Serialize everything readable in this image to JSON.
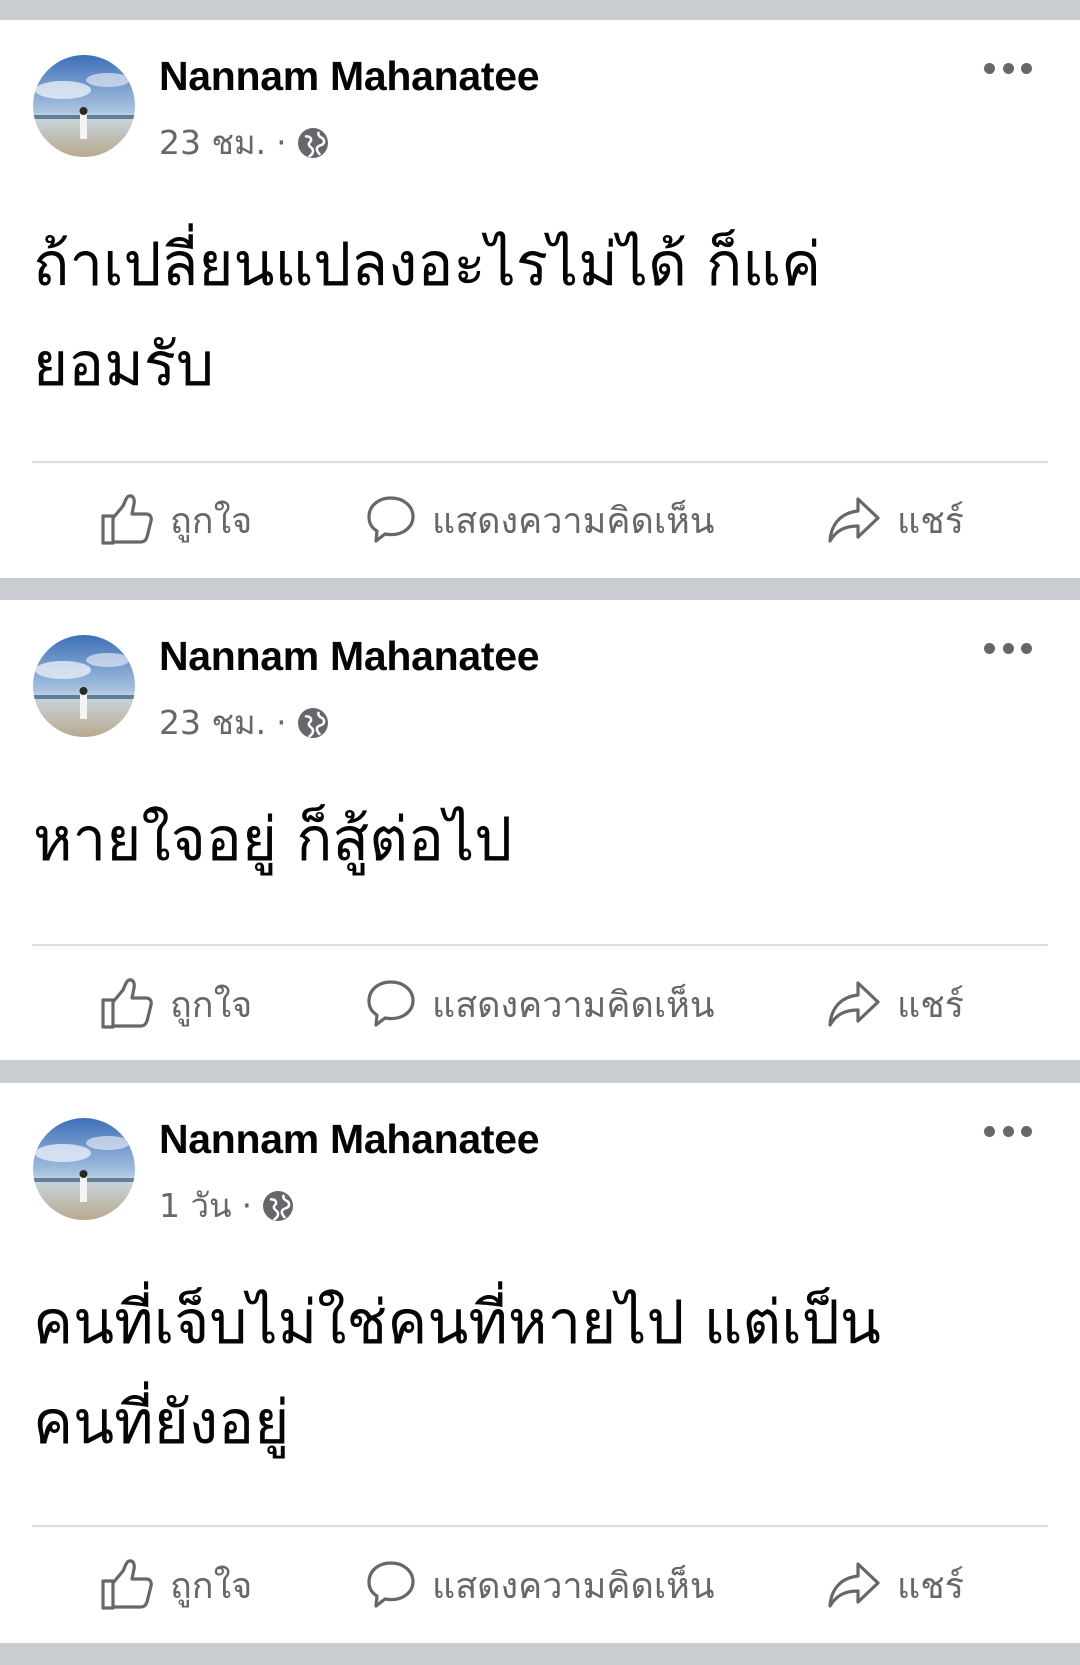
{
  "posts": [
    {
      "author": "Nannam Mahanatee",
      "time": "23 ชม.",
      "separator": "·",
      "privacy_icon": "globe-icon",
      "text": "ถ้าเปลี่ยนแปลงอะไรไม่ได้ ก็แค่\nยอมรับ",
      "actions": {
        "like": "ถูกใจ",
        "comment": "แสดงความคิดเห็น",
        "share": "แชร์"
      }
    },
    {
      "author": "Nannam Mahanatee",
      "time": "23 ชม.",
      "separator": "·",
      "privacy_icon": "globe-icon",
      "text": "หายใจอยู่ ก็สู้ต่อไป",
      "actions": {
        "like": "ถูกใจ",
        "comment": "แสดงความคิดเห็น",
        "share": "แชร์"
      }
    },
    {
      "author": "Nannam Mahanatee",
      "time": "1 วัน",
      "separator": "·",
      "privacy_icon": "globe-icon",
      "text": "คนที่เจ็บไม่ใช่คนที่หายไป แต่เป็น\nคนที่ยังอยู่",
      "actions": {
        "like": "ถูกใจ",
        "comment": "แสดงความคิดเห็น",
        "share": "แชร์"
      }
    }
  ],
  "colors": {
    "background": "#c9ccd1",
    "card": "#ffffff",
    "primary_text": "#050505",
    "secondary_text": "#65676b",
    "divider": "#dadde1"
  }
}
